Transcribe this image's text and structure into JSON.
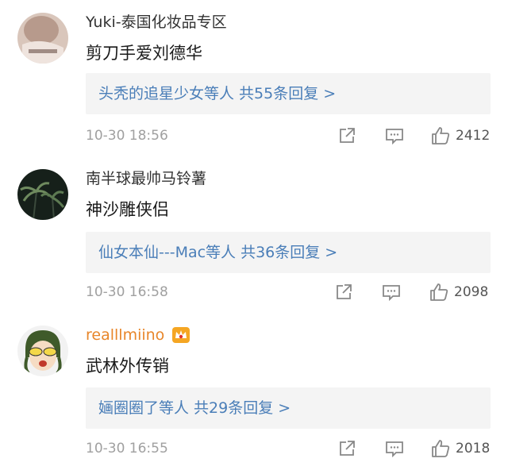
{
  "comments": [
    {
      "username": "Yuki-泰国化妆品专区",
      "content": "剪刀手爱刘德华",
      "reply_summary": "头秃的追星少女等人  共55条回复 >",
      "time": "10-30 18:56",
      "likes": "2412",
      "avatar_icon": "portrait-photo"
    },
    {
      "username": "南半球最帅马铃薯",
      "content": "神沙雕侠侣",
      "reply_summary": "仙女本仙---Mac等人  共36条回复 >",
      "time": "10-30 16:58",
      "likes": "2098",
      "avatar_icon": "palm-trees-photo"
    },
    {
      "username": "realllmiino",
      "content": "武林外传销",
      "reply_summary": "婳圈圈了等人  共29条回复 >",
      "time": "10-30 16:55",
      "likes": "2018",
      "avatar_icon": "cartoon-girl-avatar",
      "badge_icon": "vip-crown-icon"
    }
  ],
  "colors": {
    "username_vip": "#e8862a",
    "reply_link": "#4a7eb8",
    "reply_bg": "#f4f4f4",
    "meta": "#a0a0a0"
  }
}
